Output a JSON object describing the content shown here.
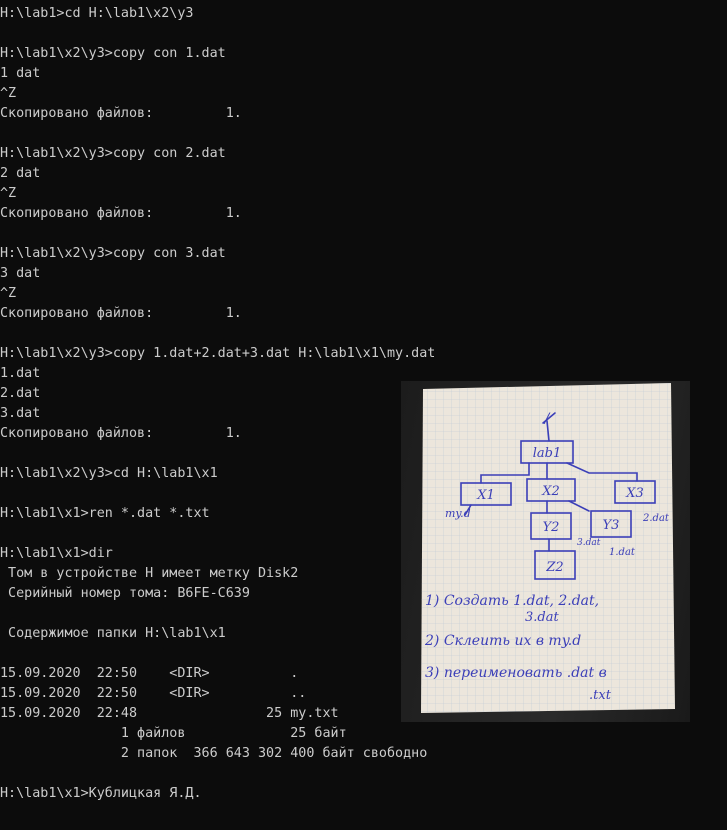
{
  "console": {
    "lines": [
      "H:\\lab1>cd H:\\lab1\\x2\\y3",
      "",
      "H:\\lab1\\x2\\y3>copy con 1.dat",
      "1 dat",
      "^Z",
      "Скопировано файлов:         1.",
      "",
      "H:\\lab1\\x2\\y3>copy con 2.dat",
      "2 dat",
      "^Z",
      "Скопировано файлов:         1.",
      "",
      "H:\\lab1\\x2\\y3>copy con 3.dat",
      "3 dat",
      "^Z",
      "Скопировано файлов:         1.",
      "",
      "H:\\lab1\\x2\\y3>copy 1.dat+2.dat+3.dat H:\\lab1\\x1\\my.dat",
      "1.dat",
      "2.dat",
      "3.dat",
      "Скопировано файлов:         1.",
      "",
      "H:\\lab1\\x2\\y3>cd H:\\lab1\\x1",
      "",
      "H:\\lab1\\x1>ren *.dat *.txt",
      "",
      "H:\\lab1\\x1>dir",
      " Том в устройстве H имеет метку Disk2",
      " Серийный номер тома: B6FE-C639",
      "",
      " Содержимое папки H:\\lab1\\x1",
      "",
      "15.09.2020  22:50    <DIR>          .",
      "15.09.2020  22:50    <DIR>          ..",
      "15.09.2020  22:48                25 my.txt",
      "               1 файлов             25 байт",
      "               2 папок  366 643 302 400 байт свободно",
      "",
      "H:\\lab1\\x1>Кублицкая Я.Д."
    ]
  },
  "note": {
    "root": "/",
    "lab": "lab1",
    "x1": "X1",
    "x2": "X2",
    "x3": "X3",
    "y2": "Y2",
    "y3": "Y3",
    "z2": "Z2",
    "myd": "my.d",
    "d2": "2.dat",
    "d3": "3.dat",
    "d1": "1.dat",
    "task1a": "1) Создать  1.dat, 2.dat,",
    "task1b": "3.dat",
    "task2": "2) Склеить  их в my.d",
    "task3a": "3) переименовать  .dat в",
    "task3b": ".txt"
  },
  "colors": {
    "background": "#0c0c0c",
    "text": "#cccccc",
    "ink": "#3b3fb8",
    "paper": "#ece6dc"
  }
}
